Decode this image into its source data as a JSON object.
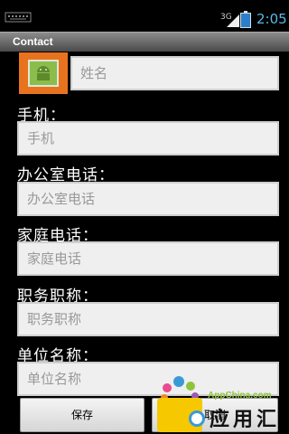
{
  "status_bar": {
    "network": "3G",
    "time": "2:05"
  },
  "title_bar": {
    "title": "Contact"
  },
  "form": {
    "name": {
      "placeholder": "姓名"
    },
    "mobile": {
      "label": "手机：",
      "placeholder": "手机"
    },
    "office_phone": {
      "label": "办公室电话：",
      "placeholder": "办公室电话"
    },
    "home_phone": {
      "label": "家庭电话：",
      "placeholder": "家庭电话"
    },
    "job_title": {
      "label": "职务职称：",
      "placeholder": "职务职称"
    },
    "company": {
      "label": "单位名称：",
      "placeholder": "单位名称"
    }
  },
  "buttons": {
    "save": "保存",
    "cancel": "取消"
  },
  "watermark": {
    "url": "AppChina.com",
    "name": "应用汇"
  },
  "colors": {
    "avatar_bg": "#e8731f",
    "time": "#5ab9e6",
    "watermark_green": "#8ec43a"
  }
}
